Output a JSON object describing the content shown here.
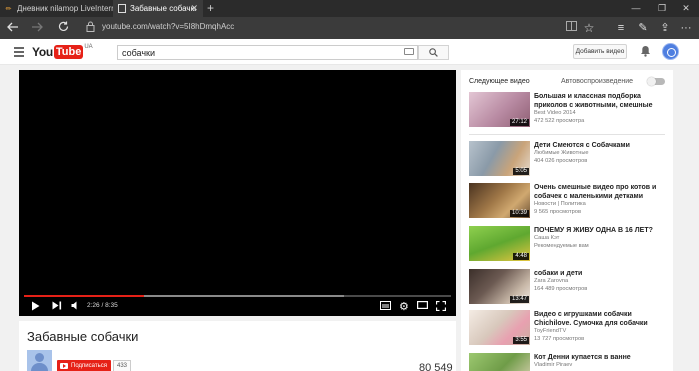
{
  "browser": {
    "tabs": [
      {
        "title": "Дневник nilamop LiveInternet",
        "active": false
      },
      {
        "title": "Забавные собачки - Yo",
        "active": true
      }
    ],
    "url": "youtube.com/watch?v=5I8hDmqhAcc"
  },
  "header": {
    "logo_you": "You",
    "logo_tube": "Tube",
    "logo_region": "UA",
    "search_value": "собачки",
    "upload_label": "Добавить видео"
  },
  "player": {
    "time": "2:26 / 8:35",
    "played_fraction": 0.28,
    "loaded_fraction": 0.75
  },
  "video": {
    "title": "Забавные собачки",
    "subscribe_label": "Подписаться",
    "subscriber_count": "433",
    "views": "80 549"
  },
  "sidebar": {
    "next_label": "Следующее видео",
    "autoplay_label": "Автовоспроизведение",
    "items": [
      {
        "title": "Большая и классная подборка приколов с животными, смешные коты, собаки,",
        "channel": "Best Video 2014",
        "views": "472 522 просмотра",
        "duration": "27:12",
        "thumb_color": "#c9a6b8"
      },
      {
        "title": "Дети Смеются с Собачками",
        "channel": "Любимые Животные",
        "views": "404 026 просмотров",
        "duration": "5:05",
        "thumb_color": "#8a9aa8"
      },
      {
        "title": "Очень смешные видео про котов и собачек с маленькими детками Funny",
        "channel": "Новости | Политика",
        "views": "9 565 просмотров",
        "duration": "10:39",
        "thumb_color": "#a07848"
      },
      {
        "title": "ПОЧЕМУ Я ЖИВУ ОДНА В 16 ЛЕТ?",
        "channel": "Саша Кэт",
        "views": "Рекомендуемые вам",
        "duration": "4:48",
        "thumb_color": "#6cb43a"
      },
      {
        "title": "собаки и дети",
        "channel": "Zara Zarovna",
        "views": "164 489 просмотров",
        "duration": "13:47",
        "thumb_color": "#6c5a52"
      },
      {
        "title": "Видео с игрушками собачки Chichilove. Сумочка для собачки Чичи. Детское",
        "channel": "ToyFriendTV",
        "views": "13 727 просмотров",
        "duration": "3:55",
        "thumb_color": "#d8d0c8"
      },
      {
        "title": "Кот Денни купается в ванне",
        "channel": "Vladimir Piraev",
        "views": "",
        "duration": "",
        "thumb_color": "#6f9c48"
      }
    ]
  }
}
